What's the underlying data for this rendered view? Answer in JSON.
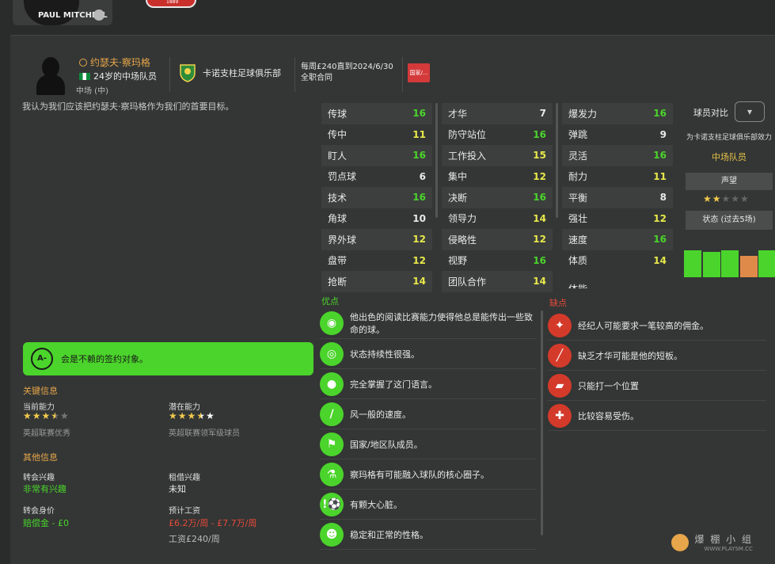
{
  "topbar": {
    "manager_name": "PAUL MITCHELL",
    "logo_year": "1889"
  },
  "player": {
    "name": "约瑟夫·察玛格",
    "age_role": "24岁的中场队员",
    "position": "中场 (中)",
    "club": "卡诺支柱足球俱乐部",
    "contract_line1": "每周£240直到2024/6/30",
    "contract_line2": "全职合同",
    "nat_tag": "国家/...",
    "intro": "我认为我们应该把约瑟夫·察玛格作为我们的首要目标。"
  },
  "attributes": {
    "col1": [
      {
        "n": "传球",
        "v": "16",
        "c": "#4bd42b"
      },
      {
        "n": "传中",
        "v": "11",
        "c": "#e8e84a"
      },
      {
        "n": "盯人",
        "v": "16",
        "c": "#4bd42b"
      },
      {
        "n": "罚点球",
        "v": "6",
        "c": "#e8e8e8"
      },
      {
        "n": "技术",
        "v": "16",
        "c": "#4bd42b"
      },
      {
        "n": "角球",
        "v": "10",
        "c": "#e8e8e8"
      },
      {
        "n": "界外球",
        "v": "12",
        "c": "#e8e84a"
      },
      {
        "n": "盘带",
        "v": "12",
        "c": "#e8e84a"
      },
      {
        "n": "抢断",
        "v": "14",
        "c": "#e8e84a"
      }
    ],
    "col2": [
      {
        "n": "才华",
        "v": "7",
        "c": "#e8e8e8"
      },
      {
        "n": "防守站位",
        "v": "16",
        "c": "#4bd42b"
      },
      {
        "n": "工作投入",
        "v": "15",
        "c": "#e8e84a"
      },
      {
        "n": "集中",
        "v": "12",
        "c": "#e8e84a"
      },
      {
        "n": "决断",
        "v": "16",
        "c": "#4bd42b"
      },
      {
        "n": "领导力",
        "v": "14",
        "c": "#e8e84a"
      },
      {
        "n": "侵略性",
        "v": "12",
        "c": "#e8e84a"
      },
      {
        "n": "视野",
        "v": "16",
        "c": "#4bd42b"
      },
      {
        "n": "团队合作",
        "v": "14",
        "c": "#e8e84a"
      }
    ],
    "col3": [
      {
        "n": "爆发力",
        "v": "16",
        "c": "#4bd42b"
      },
      {
        "n": "弹跳",
        "v": "9",
        "c": "#e8e8e8"
      },
      {
        "n": "灵活",
        "v": "16",
        "c": "#4bd42b"
      },
      {
        "n": "耐力",
        "v": "11",
        "c": "#e8e84a"
      },
      {
        "n": "平衡",
        "v": "8",
        "c": "#e8e8e8"
      },
      {
        "n": "强壮",
        "v": "12",
        "c": "#e8e84a"
      },
      {
        "n": "速度",
        "v": "16",
        "c": "#4bd42b"
      },
      {
        "n": "体质",
        "v": "14",
        "c": "#e8e84a"
      }
    ],
    "col3_cut": "体能"
  },
  "side": {
    "compare_label": "球员对比",
    "compare_btn": "▾",
    "club_for": "为卡诺支柱足球俱乐部效力",
    "role": "中场队员",
    "rep_header": "声望",
    "rep_stars": "★★★★★",
    "form_header": "状态 (过去5场)",
    "form_values": [
      0.95,
      0.9,
      0.95,
      0.75,
      0.95
    ],
    "form_colors": [
      "#4bd42b",
      "#4bd42b",
      "#4bd42b",
      "#e08a4a",
      "#4bd42b"
    ]
  },
  "grade": {
    "letter": "A-",
    "text": "会是不赖的签约对象。"
  },
  "key": {
    "title": "关键信息",
    "ca_label": "当前能力",
    "ca_full": "★★★",
    "ca_half": "★",
    "ca_empty": "★",
    "ca_sub": "英超联赛优秀",
    "pa_label": "潜在能力",
    "pa_full": "★★★",
    "pa_half": "★",
    "pa_rest": "★",
    "pa_sub": "英超联赛领军级球员"
  },
  "other": {
    "title": "其他信息",
    "ti_label": "转会兴趣",
    "ti_val": "非常有兴趣",
    "li_label": "租借兴趣",
    "li_val": "未知",
    "tv_label": "转会身价",
    "tv_val": "赔偿金 - £0",
    "ew_label": "预计工资",
    "ew_val": "£6.2万/周 - £7.7万/周",
    "wage": "工资£240/周"
  },
  "pros": {
    "title": "优点",
    "items": [
      {
        "t": "他出色的阅读比赛能力使得他总是能传出一些致命的球。",
        "i": "◉"
      },
      {
        "t": "状态持续性很强。",
        "i": "◎"
      },
      {
        "t": "完全掌握了这门语言。",
        "i": "●"
      },
      {
        "t": "风一般的速度。",
        "i": "/"
      },
      {
        "t": "国家/地区队成员。",
        "i": "⚑"
      },
      {
        "t": "察玛格有可能融入球队的核心圈子。",
        "i": "⚗"
      },
      {
        "t": "有颗大心脏。",
        "i": "!⚽"
      },
      {
        "t": "稳定和正常的性格。",
        "i": "☻"
      }
    ]
  },
  "cons": {
    "title": "缺点",
    "items": [
      {
        "t": "经纪人可能要求一笔较高的佣金。",
        "i": "✦"
      },
      {
        "t": "缺乏才华可能是他的短板。",
        "i": "╱"
      },
      {
        "t": "只能打一个位置",
        "i": "▰"
      },
      {
        "t": "比较容易受伤。",
        "i": "✚"
      }
    ]
  },
  "watermark": {
    "line1": "爆 棚 小 组",
    "line2": "WWW.PLAYSM.CC"
  }
}
